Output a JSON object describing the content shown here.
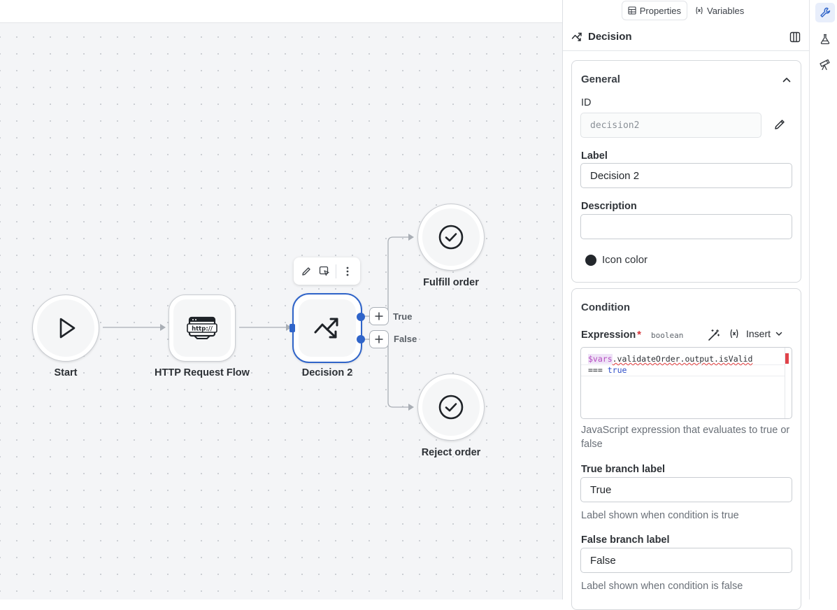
{
  "nodes": {
    "start": "Start",
    "http": "HTTP Request Flow",
    "http_badge": "http://",
    "decision": "Decision 2",
    "fulfill": "Fulfill order",
    "reject": "Reject order"
  },
  "branches": {
    "true_label": "True",
    "false_label": "False"
  },
  "panel": {
    "tabs": [
      {
        "label": "Properties",
        "icon": "table-icon",
        "active": true
      },
      {
        "label": "Variables",
        "icon": "variable-icon",
        "active": false
      }
    ],
    "node_title": "Decision",
    "general": {
      "title": "General",
      "id_label": "ID",
      "id_value": "decision2",
      "label_label": "Label",
      "label_value": "Decision 2",
      "description_label": "Description",
      "description_value": "",
      "icon_color_label": "Icon color",
      "icon_color": "#23272c"
    },
    "condition": {
      "title": "Condition",
      "expression_label": "Expression",
      "required_mark": "*",
      "type_hint": "boolean",
      "insert_label": "Insert",
      "code_line1_var": "$vars",
      "code_line1_rest": ".validateOrder.output.isValid",
      "code_line2_op": "===",
      "code_line2_val": "true",
      "expression_help": "JavaScript expression that evaluates to true or false",
      "true_label_title": "True branch label",
      "true_label_value": "True",
      "true_help": "Label shown when condition is true",
      "false_label_title": "False branch label",
      "false_label_value": "False",
      "false_help": "Label shown when condition is false"
    }
  },
  "colors": {
    "accent": "#2f64c9",
    "required": "#d6343a"
  }
}
